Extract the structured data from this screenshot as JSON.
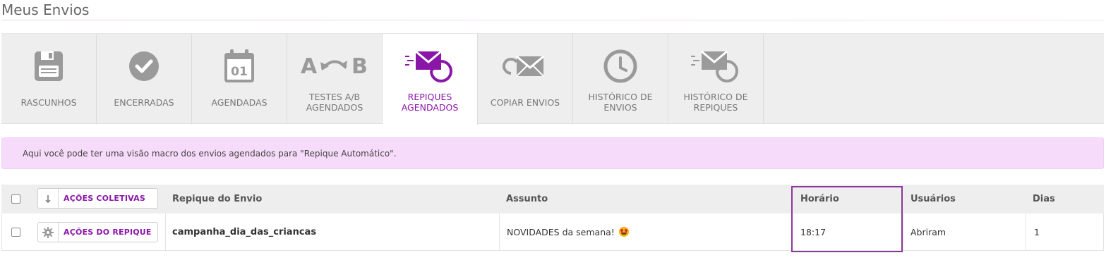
{
  "page": {
    "title": "Meus Envios"
  },
  "tabs": [
    {
      "label_1": "RASCUNHOS",
      "label_2": "",
      "icon": "floppy-icon",
      "active": false
    },
    {
      "label_1": "ENCERRADAS",
      "label_2": "",
      "icon": "check-circle-icon",
      "active": false
    },
    {
      "label_1": "AGENDADAS",
      "label_2": "",
      "icon": "calendar-icon",
      "active": false
    },
    {
      "label_1": "TESTES A/B",
      "label_2": "AGENDADOS",
      "icon": "ab-test-icon",
      "active": false
    },
    {
      "label_1": "REPIQUES",
      "label_2": "AGENDADOS",
      "icon": "scheduled-resend-icon",
      "active": true
    },
    {
      "label_1": "COPIAR ENVIOS",
      "label_2": "",
      "icon": "copy-envelope-icon",
      "active": false
    },
    {
      "label_1": "HISTÓRICO DE",
      "label_2": "ENVIOS",
      "icon": "clock-icon",
      "active": false
    },
    {
      "label_1": "HISTÓRICO DE",
      "label_2": "REPIQUES",
      "icon": "resend-history-icon",
      "active": false
    }
  ],
  "calendar_day": "01",
  "ab_letters": {
    "a": "A",
    "b": "B"
  },
  "info": {
    "text": "Aqui você pode ter uma visão macro dos envios agendados para \"Repique Automático\"."
  },
  "table": {
    "bulk_action_label": "AÇÕES COLETIVAS",
    "columns": {
      "repique": "Repique do Envio",
      "assunto": "Assunto",
      "horario": "Horário",
      "usuarios": "Usuários",
      "dias": "Dias"
    },
    "rows": [
      {
        "action_label": "AÇÕES DO REPIQUE",
        "repique": "campanha_dia_das_criancas",
        "assunto": "NOVIDADES da semana!",
        "assunto_emoji": "smiling-face-with-heart-eyes",
        "horario": "18:17",
        "usuarios": "Abriram",
        "dias": "1"
      }
    ]
  },
  "colors": {
    "accent": "#8a16a8",
    "info_bg": "#f6dcfa",
    "highlight_border": "#8a3a97",
    "icon_gray": "#9a9a9a"
  }
}
